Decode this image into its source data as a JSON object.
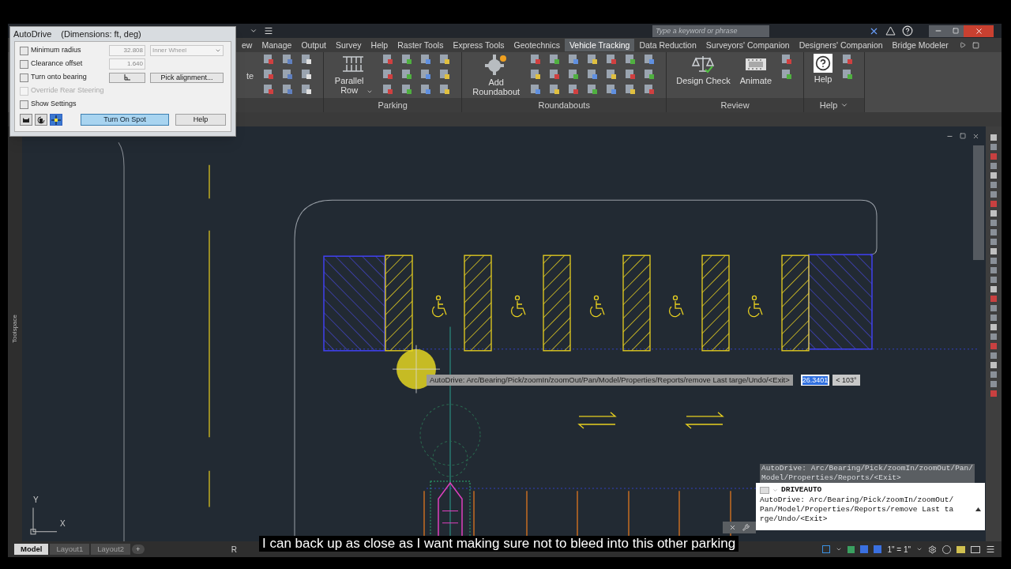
{
  "app": {
    "search_placeholder": "Type a keyword or phrase"
  },
  "ribbon_tabs": [
    {
      "label": "ew",
      "selected": false
    },
    {
      "label": "Manage",
      "selected": false
    },
    {
      "label": "Output",
      "selected": false
    },
    {
      "label": "Survey",
      "selected": false
    },
    {
      "label": "Help",
      "selected": false
    },
    {
      "label": "Raster Tools",
      "selected": false
    },
    {
      "label": "Express Tools",
      "selected": false
    },
    {
      "label": "Geotechnics",
      "selected": false
    },
    {
      "label": "Vehicle Tracking",
      "selected": true
    },
    {
      "label": "Data Reduction",
      "selected": false
    },
    {
      "label": "Surveyors' Companion",
      "selected": false
    },
    {
      "label": "Designers' Companion",
      "selected": false
    },
    {
      "label": "Bridge Modeler",
      "selected": false
    }
  ],
  "ribbon_panels": [
    {
      "kind": "partial",
      "large_buttons": [
        {
          "label": "te"
        }
      ]
    },
    {
      "kind": "parking",
      "title": "Parking",
      "title_menu": false,
      "large_buttons": [
        {
          "label": "Parallel Row",
          "dropdown": true
        }
      ]
    },
    {
      "kind": "roundabouts",
      "title": "Roundabouts",
      "title_menu": false,
      "large_buttons": [
        {
          "label": "Add Roundabout",
          "dropdown": false
        }
      ]
    },
    {
      "kind": "review",
      "title": "Review",
      "title_menu": false,
      "large_buttons": [
        {
          "label": "Design Check",
          "dropdown": false
        },
        {
          "label": "Animate",
          "dropdown": false
        }
      ]
    },
    {
      "kind": "help",
      "title": "Help",
      "title_menu": true,
      "large_buttons": [
        {
          "label": "Help",
          "dropdown": false
        }
      ]
    }
  ],
  "dialog": {
    "title": "AutoDrive",
    "subtitle": "(Dimensions: ft, deg)",
    "options": [
      {
        "kind": "value_select",
        "label": "Minimum radius",
        "checked": false,
        "disabled": false,
        "value": "32.808",
        "select": "Inner Wheel"
      },
      {
        "kind": "value",
        "label": "Clearance offset",
        "checked": false,
        "disabled": false,
        "value": "1.640"
      },
      {
        "kind": "buttons",
        "label": "Turn onto bearing",
        "checked": false,
        "disabled": false,
        "button": "Pick alignment..."
      },
      {
        "kind": "plain",
        "label": "Override Rear Steering",
        "checked": false,
        "disabled": true
      },
      {
        "kind": "plain",
        "label": "Show Settings",
        "checked": false,
        "disabled": false
      }
    ],
    "buttons": [
      {
        "label": "Turn On Spot",
        "default": true
      },
      {
        "label": "Help",
        "default": false
      }
    ]
  },
  "viewport": {
    "toolspace_label": "Toolspace",
    "axis_x": "X",
    "axis_y": "Y",
    "prompt": {
      "text": "AutoDrive: Arc/Bearing/Pick/zoomIn/zoomOut/Pan/Model/Properties/Reports/remove Last targe/Undo/<Exit>",
      "value": "26.3401",
      "angle": "< 103°"
    }
  },
  "command_line": {
    "history": "AutoDrive: Arc/Bearing/Pick/zoomIn/zoomOut/Pan/Model/Properties/Reports/<Exit>",
    "command": "DRIVEAUTO",
    "prompt": "AutoDrive: Arc/Bearing/Pick/zoomIn/zoomOut/Pan/Model/Properties/Reports/remove Last targe/Undo/<Exit>"
  },
  "layout_tabs": [
    {
      "label": "Model",
      "selected": true
    },
    {
      "label": "Layout1",
      "selected": false
    },
    {
      "label": "Layout2",
      "selected": false
    }
  ],
  "add_tab": "+",
  "status_bar": {
    "covered_text": "R",
    "scale": "1\" = 1\""
  },
  "caption": "I can back up as close as I want making sure not to bleed into this other parking"
}
